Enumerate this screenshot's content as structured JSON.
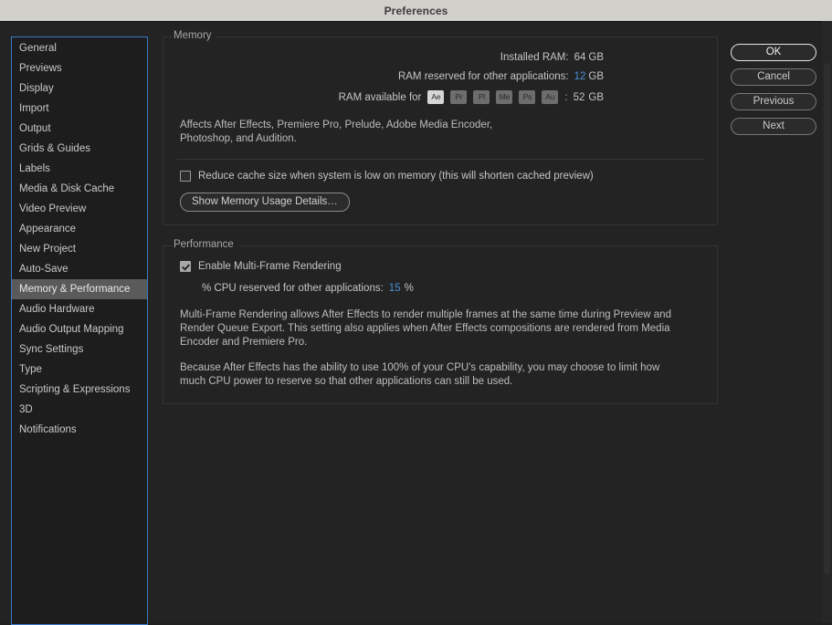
{
  "window": {
    "title": "Preferences"
  },
  "sidebar": {
    "items": [
      {
        "label": "General",
        "selected": false
      },
      {
        "label": "Previews",
        "selected": false
      },
      {
        "label": "Display",
        "selected": false
      },
      {
        "label": "Import",
        "selected": false
      },
      {
        "label": "Output",
        "selected": false
      },
      {
        "label": "Grids & Guides",
        "selected": false
      },
      {
        "label": "Labels",
        "selected": false
      },
      {
        "label": "Media & Disk Cache",
        "selected": false
      },
      {
        "label": "Video Preview",
        "selected": false
      },
      {
        "label": "Appearance",
        "selected": false
      },
      {
        "label": "New Project",
        "selected": false
      },
      {
        "label": "Auto-Save",
        "selected": false
      },
      {
        "label": "Memory & Performance",
        "selected": true
      },
      {
        "label": "Audio Hardware",
        "selected": false
      },
      {
        "label": "Audio Output Mapping",
        "selected": false
      },
      {
        "label": "Sync Settings",
        "selected": false
      },
      {
        "label": "Type",
        "selected": false
      },
      {
        "label": "Scripting & Expressions",
        "selected": false
      },
      {
        "label": "3D",
        "selected": false
      },
      {
        "label": "Notifications",
        "selected": false
      }
    ]
  },
  "memory": {
    "group_title": "Memory",
    "installed_ram_label": "Installed RAM:",
    "installed_ram_value": "64",
    "installed_ram_unit": "GB",
    "reserved_label": "RAM reserved for other applications:",
    "reserved_value": "12",
    "reserved_unit": "GB",
    "available_label": "RAM available for",
    "apps": [
      {
        "code": "Ae",
        "name": "after-effects",
        "active": true
      },
      {
        "code": "Pr",
        "name": "premiere-pro",
        "active": false
      },
      {
        "code": "Pl",
        "name": "prelude",
        "active": false
      },
      {
        "code": "Me",
        "name": "media-encoder",
        "active": false
      },
      {
        "code": "Ps",
        "name": "photoshop",
        "active": false
      },
      {
        "code": "Au",
        "name": "audition",
        "active": false
      }
    ],
    "available_separator": ":",
    "available_value": "52",
    "available_unit": "GB",
    "affects_line1": "Affects After Effects, Premiere Pro, Prelude, Adobe Media Encoder,",
    "affects_line2": "Photoshop, and Audition.",
    "reduce_cache_label": "Reduce cache size when system is low on memory (this will shorten cached preview)",
    "reduce_cache_checked": false,
    "show_details_button": "Show Memory Usage Details…"
  },
  "performance": {
    "group_title": "Performance",
    "mfr_label": "Enable Multi-Frame Rendering",
    "mfr_checked": true,
    "cpu_label": "% CPU reserved for other applications:",
    "cpu_value": "15",
    "cpu_unit": "%",
    "paragraph1": "Multi-Frame Rendering allows After Effects to render multiple frames at the same time during Preview and Render Queue Export. This setting also applies when After Effects compositions are rendered from Media Encoder and Premiere Pro.",
    "paragraph2": "Because After Effects has the ability to use 100% of your CPU's capability, you may choose to limit how much CPU power to reserve so that other applications can still be used."
  },
  "buttons": {
    "ok": "OK",
    "cancel": "Cancel",
    "previous": "Previous",
    "next": "Next"
  },
  "colors": {
    "accent_blue": "#4b8fd4",
    "focus_border": "#3c77c4",
    "titlebar_bg": "#d2d0cb",
    "dialog_bg": "#232323",
    "selected_item_bg": "#5a5a5a"
  }
}
